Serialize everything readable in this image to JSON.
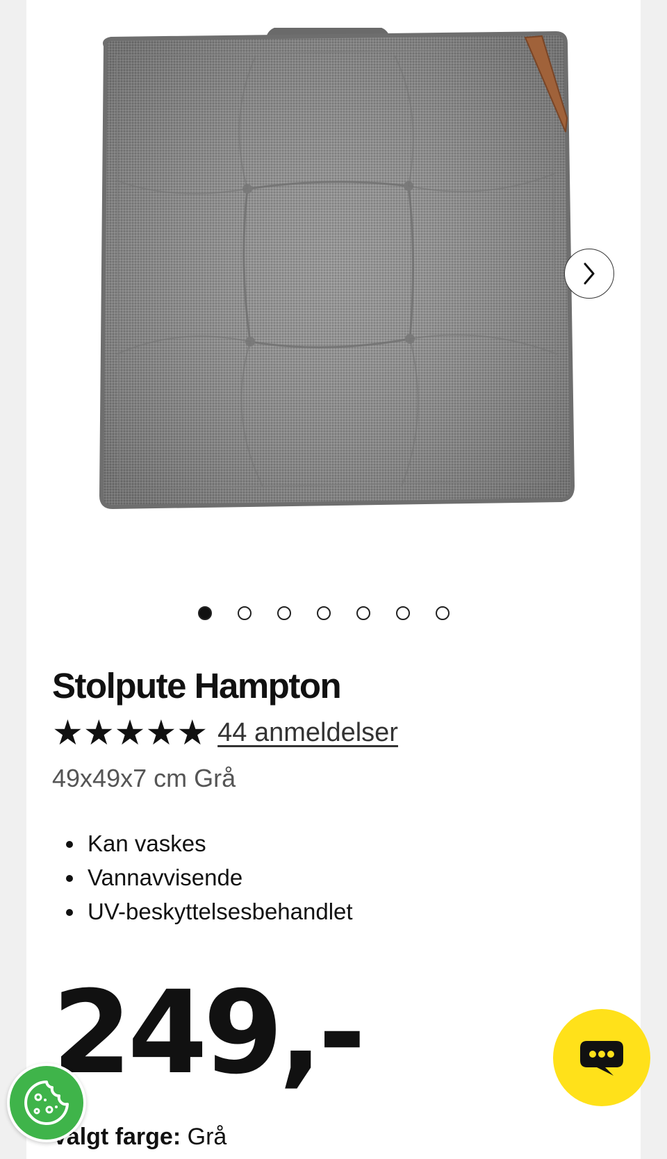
{
  "gallery": {
    "image_alt": "Stolpute Hampton – grå",
    "dot_count": 7,
    "active_dot": 0,
    "next_icon": "chevron-right-icon"
  },
  "product": {
    "title": "Stolpute Hampton",
    "rating": 5,
    "rating_max": 5,
    "reviews_label": "44 anmeldelser",
    "variant": "49x49x7 cm Grå",
    "features": [
      "Kan vaskes",
      "Vannavvisende",
      "UV-beskyttelsesbehandlet"
    ],
    "price": "249,-",
    "selected_color_label": "Valgt farge:",
    "selected_color_value": "Grå"
  },
  "floating": {
    "chat_icon": "chat-bubble-icon",
    "cookie_icon": "cookie-icon"
  },
  "colors": {
    "chat_button": "#ffe11a",
    "cookie_button": "#3fb44a",
    "background": "#f0f0f0"
  }
}
